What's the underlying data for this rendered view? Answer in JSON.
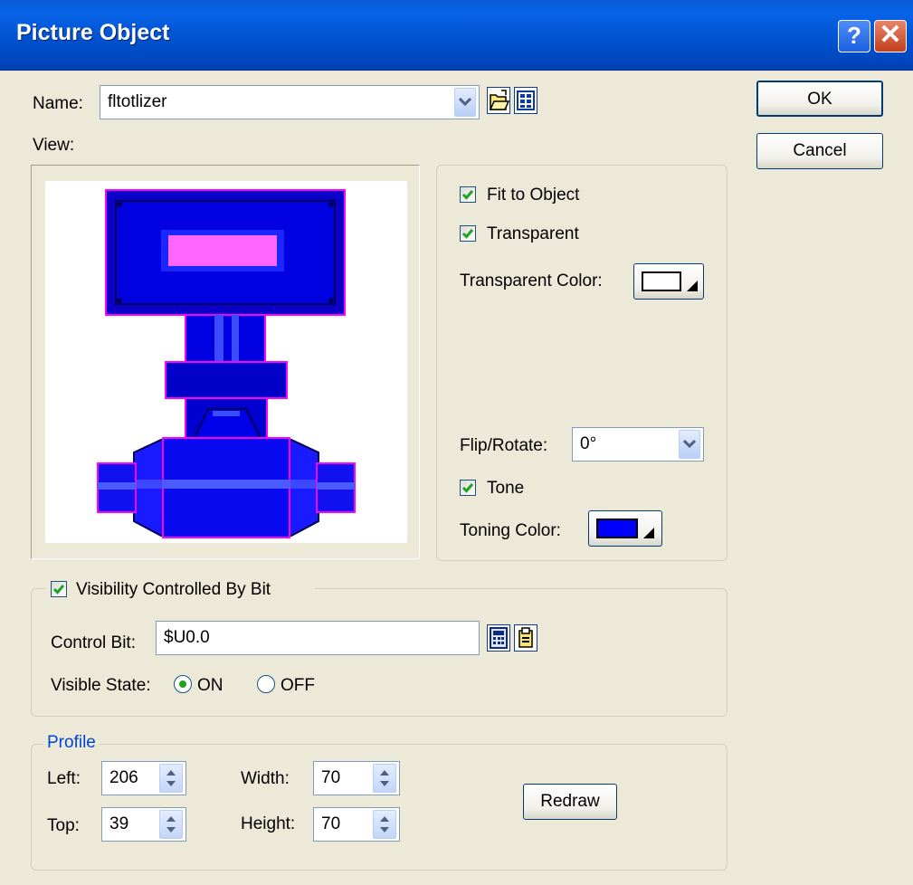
{
  "window": {
    "title": "Picture Object",
    "help_glyph": "?",
    "close_glyph": "✕"
  },
  "name_row": {
    "label": "Name:",
    "value": "fltotlizer",
    "open_icon": "folder-open-icon",
    "library_icon": "library-grid-icon"
  },
  "view": {
    "label": "View:",
    "fit_to_object": {
      "label": "Fit to Object",
      "checked": true
    },
    "transparent": {
      "label": "Transparent",
      "checked": true
    },
    "transparent_color": {
      "label": "Transparent Color:",
      "color": "#ffffff"
    },
    "flip_rotate": {
      "label": "Flip/Rotate:",
      "value": "0°"
    },
    "tone": {
      "label": "Tone",
      "checked": true
    },
    "toning_color": {
      "label": "Toning Color:",
      "color": "#0000ff"
    }
  },
  "visibility": {
    "label": "Visibility Controlled By Bit",
    "checked": true,
    "control_bit_label": "Control Bit:",
    "control_bit_value": "$U0.0",
    "visible_state_label": "Visible State:",
    "on_label": "ON",
    "off_label": "OFF",
    "selected": "ON"
  },
  "profile": {
    "legend": "Profile",
    "left_label": "Left:",
    "left_value": "206",
    "top_label": "Top:",
    "top_value": "39",
    "width_label": "Width:",
    "width_value": "70",
    "height_label": "Height:",
    "height_value": "70",
    "redraw_label": "Redraw"
  },
  "buttons": {
    "ok": "OK",
    "cancel": "Cancel"
  },
  "colors": {
    "titlebar": "#0052d0",
    "dialog": "#ece9d8",
    "legend_text": "#0046d5",
    "check": "#21a121"
  }
}
